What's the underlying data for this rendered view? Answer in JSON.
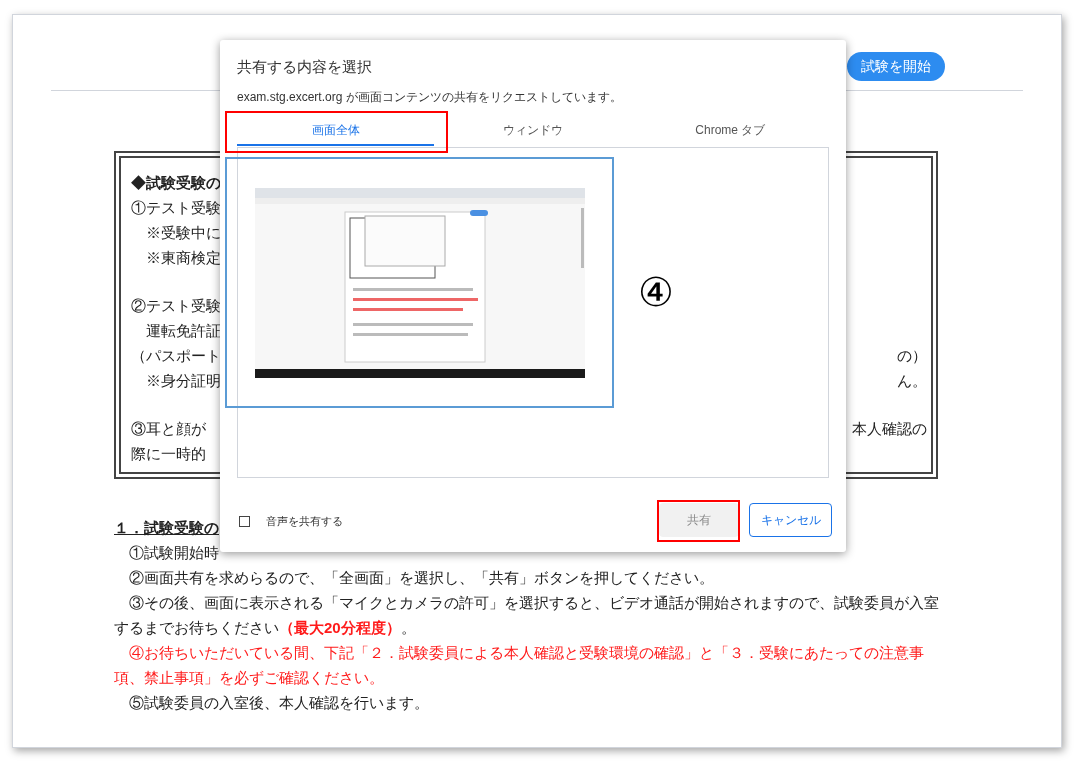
{
  "page": {
    "start_button": "試験を開始",
    "notice": [
      [
        {
          "text": "◆試験受験の",
          "bold": true
        },
        {
          "text": "①テスト受験",
          "bold": false
        },
        {
          "text": "　※受験中に",
          "bold": false
        },
        {
          "text": "　※東商検定",
          "bold": false
        }
      ],
      [
        {
          "text": "②テスト受験",
          "bold": false
        },
        {
          "text": "　運転免許証",
          "bold": false
        },
        {
          "text": "（パスポート",
          "tail": "の）",
          "bold": false
        },
        {
          "text": "　※身分証明",
          "tail": "ん。",
          "bold": false
        }
      ],
      [
        {
          "text": "③耳と顔が",
          "tail": "本人確認の",
          "bold": false
        },
        {
          "text": "際に一時的",
          "bold": false
        }
      ]
    ],
    "section": {
      "heading": "１．試験受験の",
      "lines": [
        [
          {
            "text": "　①試験開始時",
            "kind": "normal"
          }
        ],
        [
          {
            "text": "　②画面共有を求めらるので、「全画面」を選択し、「共有」ボタンを押してください。",
            "kind": "normal"
          }
        ],
        [
          {
            "text": "　③その後、画面に表示される「マイクとカメラの許可」を選択すると、ビデオ通話が開始されますので、試験委員が入室するまでお待ちください",
            "kind": "normal"
          },
          {
            "text": "（最大20分程度）",
            "kind": "alert"
          },
          {
            "text": "。",
            "kind": "normal"
          }
        ],
        [
          {
            "text": "　④お待ちいただいている間、下記「２．試験委員による本人確認と受験環境の確認」と「３．受験にあたっての注意事項、禁止事項」を必ずご確認ください。",
            "kind": "warning"
          }
        ],
        [
          {
            "text": "　⑤試験委員の入室後、本人確認を行います。",
            "kind": "normal"
          }
        ]
      ]
    }
  },
  "dialog": {
    "title": "共有する内容を選択",
    "subtitle": "exam.stg.excert.org が画面コンテンツの共有をリクエストしています。",
    "tabs": [
      {
        "label": "画面全体",
        "selected": true
      },
      {
        "label": "ウィンドウ",
        "selected": false
      },
      {
        "label": "Chrome タブ",
        "selected": false
      }
    ],
    "screens": [
      {
        "kind": "picture",
        "selected": true
      }
    ],
    "share_audio": {
      "label": "音声を共有する",
      "checked": false
    },
    "buttons": [
      {
        "label": "共有",
        "disabled": true
      },
      {
        "label": "キャンセル",
        "disabled": false
      }
    ]
  },
  "annotation": {
    "label": "④"
  }
}
